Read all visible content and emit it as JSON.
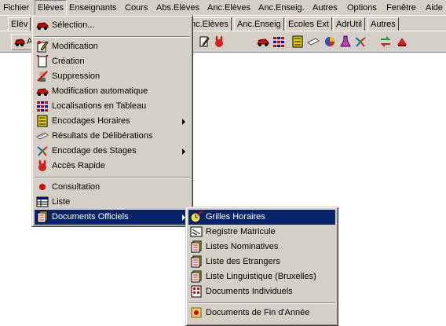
{
  "menubar": {
    "items": [
      "Fichier",
      "Elèves",
      "Enseignants",
      "Cours",
      "Abs.Elèves",
      "Anc.Elèves",
      "Anc.Enseig.",
      "Autres",
      "Options",
      "Fenêtre",
      "Aide"
    ]
  },
  "tabs": [
    "Elèv",
    "nc.Elèves",
    "Anc.Enseig",
    "Ecoles Ext",
    "AdrUtil",
    "Autres"
  ],
  "toolbar": {
    "first_label": "A"
  },
  "eleves_menu": {
    "items": [
      {
        "label": "Sélection...",
        "icon": "car-icon"
      },
      {
        "label": "Modification",
        "icon": "edit-icon"
      },
      {
        "label": "Création",
        "icon": "create-icon"
      },
      {
        "label": "Suppression",
        "icon": "delete-icon"
      },
      {
        "label": "Modification automatique",
        "icon": "auto-car-icon"
      },
      {
        "label": "Localisations en Tableau",
        "icon": "grid-icon"
      },
      {
        "label": "Encodages Horaires",
        "icon": "timetable-icon"
      },
      {
        "label": "Résultats de Délibérations",
        "icon": "diploma-icon"
      },
      {
        "label": "Encodage des Stages",
        "icon": "stage-icon"
      },
      {
        "label": "Accès Rapide",
        "icon": "rabbit-icon"
      },
      {
        "label": "Consultation",
        "icon": "red-dot-icon"
      },
      {
        "label": "Liste",
        "icon": "list-icon"
      },
      {
        "label": "Documents Officiels",
        "icon": "documents-icon"
      }
    ]
  },
  "documents_menu": {
    "items": [
      {
        "label": "Grilles Horaires",
        "icon": "clock-pencil-icon"
      },
      {
        "label": "Registre Matricule",
        "icon": "register-icon"
      },
      {
        "label": "Listes Nominatives",
        "icon": "doc-icon"
      },
      {
        "label": "Liste des Etrangers",
        "icon": "doc-icon"
      },
      {
        "label": "Liste Linguistique (Bruxelles)",
        "icon": "doc-icon"
      },
      {
        "label": "Documents Individuels",
        "icon": "doc-grid-icon"
      },
      {
        "label": "Documents de Fin d'Année",
        "icon": "certificate-icon"
      }
    ]
  },
  "colors": {
    "menu_bg": "#d4d0c8",
    "highlight": "#0a246a",
    "highlight_text": "#ffffff"
  }
}
